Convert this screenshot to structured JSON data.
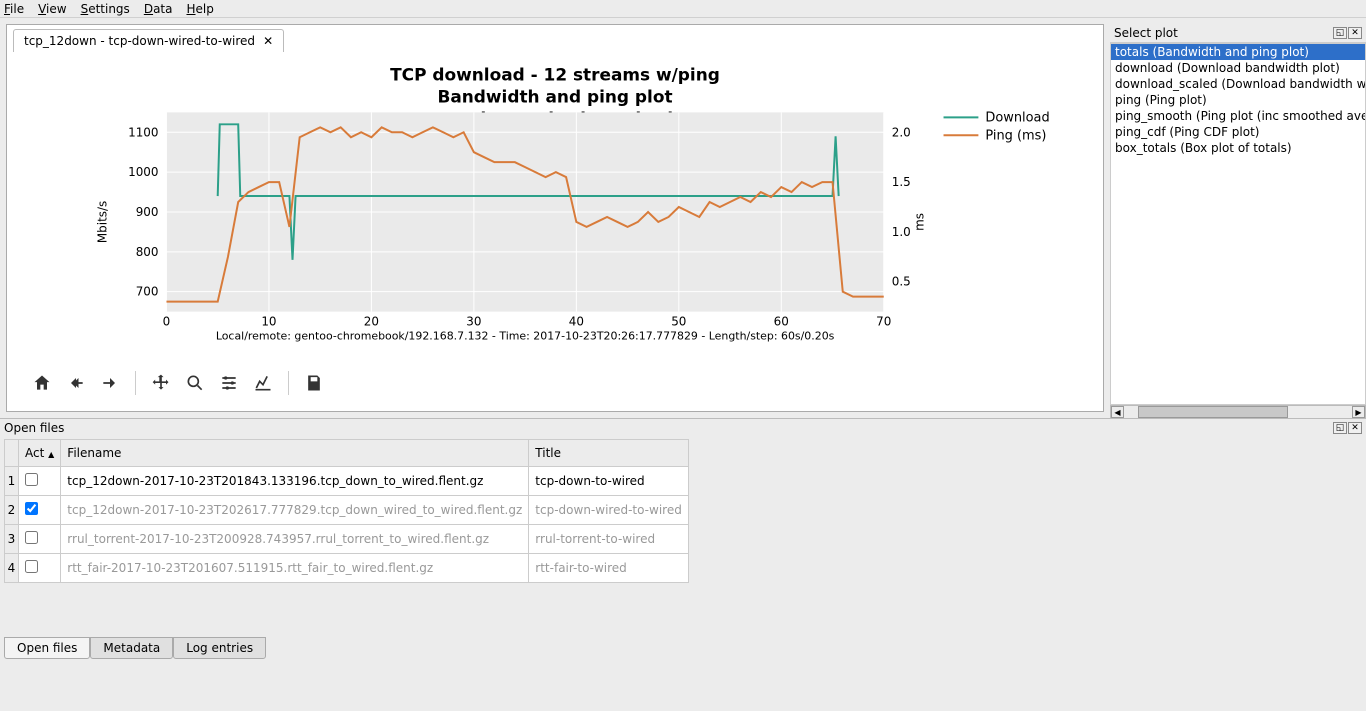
{
  "menu": {
    "file": "File",
    "view": "View",
    "settings": "Settings",
    "data": "Data",
    "help": "Help"
  },
  "tab": {
    "label": "tcp_12down - tcp-down-wired-to-wired"
  },
  "chart": {
    "title1": "TCP download - 12 streams w/ping",
    "title2": "Bandwidth and ping plot",
    "title3": "tcp-down-wired-to-wired",
    "ylabel_left": "Mbits/s",
    "ylabel_right": "ms",
    "legend_download": "Download",
    "legend_ping": "Ping (ms)",
    "footer": "Local/remote: gentoo-chromebook/192.168.7.132 - Time: 2017-10-23T20:26:17.777829 - Length/step: 60s/0.20s"
  },
  "chart_data": {
    "type": "line",
    "x_range": [
      0,
      70
    ],
    "x_ticks": [
      0,
      10,
      20,
      30,
      40,
      50,
      60,
      70
    ],
    "y_left_ticks": [
      700,
      800,
      900,
      1000,
      1100
    ],
    "y_left_range": [
      650,
      1150
    ],
    "y_right_ticks": [
      0.5,
      1.0,
      1.5,
      2.0
    ],
    "y_right_range": [
      0.2,
      2.2
    ],
    "series": [
      {
        "name": "Download",
        "axis": "left",
        "color": "#2ca089",
        "x": [
          5,
          5.2,
          7,
          7.2,
          12,
          12.3,
          12.6,
          65,
          65.3,
          65.6
        ],
        "y": [
          940,
          1120,
          1120,
          940,
          940,
          780,
          940,
          940,
          1090,
          940
        ]
      },
      {
        "name": "Ping (ms)",
        "axis": "right",
        "color": "#d87b3a",
        "x": [
          0,
          1,
          2,
          3,
          4,
          5,
          6,
          7,
          8,
          9,
          10,
          11,
          12,
          13,
          14,
          15,
          16,
          17,
          18,
          19,
          20,
          21,
          22,
          23,
          24,
          25,
          26,
          27,
          28,
          29,
          30,
          31,
          32,
          33,
          34,
          35,
          36,
          37,
          38,
          39,
          40,
          41,
          42,
          43,
          44,
          45,
          46,
          47,
          48,
          49,
          50,
          51,
          52,
          53,
          54,
          55,
          56,
          57,
          58,
          59,
          60,
          61,
          62,
          63,
          64,
          65,
          66,
          67,
          68,
          69,
          70
        ],
        "y": [
          0.3,
          0.3,
          0.3,
          0.3,
          0.3,
          0.3,
          0.75,
          1.3,
          1.4,
          1.45,
          1.5,
          1.5,
          1.05,
          1.95,
          2.0,
          2.05,
          2.0,
          2.05,
          1.95,
          2.0,
          1.95,
          2.05,
          2.0,
          2.0,
          1.95,
          2.0,
          2.05,
          2.0,
          1.95,
          2.0,
          1.8,
          1.75,
          1.7,
          1.7,
          1.7,
          1.65,
          1.6,
          1.55,
          1.6,
          1.55,
          1.1,
          1.05,
          1.1,
          1.15,
          1.1,
          1.05,
          1.1,
          1.2,
          1.1,
          1.15,
          1.25,
          1.2,
          1.15,
          1.3,
          1.25,
          1.3,
          1.35,
          1.3,
          1.4,
          1.35,
          1.45,
          1.4,
          1.5,
          1.45,
          1.5,
          1.5,
          0.4,
          0.35,
          0.35,
          0.35,
          0.35
        ]
      }
    ]
  },
  "side_panel": {
    "title": "Select plot",
    "items": [
      "totals (Bandwidth and ping plot)",
      "download (Download bandwidth plot)",
      "download_scaled (Download bandwidth w/axes scaled to remove outliers)",
      "ping (Ping plot)",
      "ping_smooth (Ping plot (inc smoothed average)",
      "ping_cdf (Ping CDF plot)",
      "box_totals (Box plot of totals)"
    ],
    "selected": 0
  },
  "open_files": {
    "title": "Open files",
    "headers": {
      "act": "Act",
      "filename": "Filename",
      "title": "Title"
    },
    "rows": [
      {
        "n": "1",
        "checked": false,
        "grey": false,
        "filename": "tcp_12down-2017-10-23T201843.133196.tcp_down_to_wired.flent.gz",
        "title": "tcp-down-to-wired"
      },
      {
        "n": "2",
        "checked": true,
        "grey": true,
        "filename": "tcp_12down-2017-10-23T202617.777829.tcp_down_wired_to_wired.flent.gz",
        "title": "tcp-down-wired-to-wired"
      },
      {
        "n": "3",
        "checked": false,
        "grey": true,
        "filename": "rrul_torrent-2017-10-23T200928.743957.rrul_torrent_to_wired.flent.gz",
        "title": "rrul-torrent-to-wired"
      },
      {
        "n": "4",
        "checked": false,
        "grey": true,
        "filename": "rtt_fair-2017-10-23T201607.511915.rtt_fair_to_wired.flent.gz",
        "title": "rtt-fair-to-wired"
      }
    ]
  },
  "bottom_tabs": {
    "open_files": "Open files",
    "metadata": "Metadata",
    "log_entries": "Log entries"
  }
}
